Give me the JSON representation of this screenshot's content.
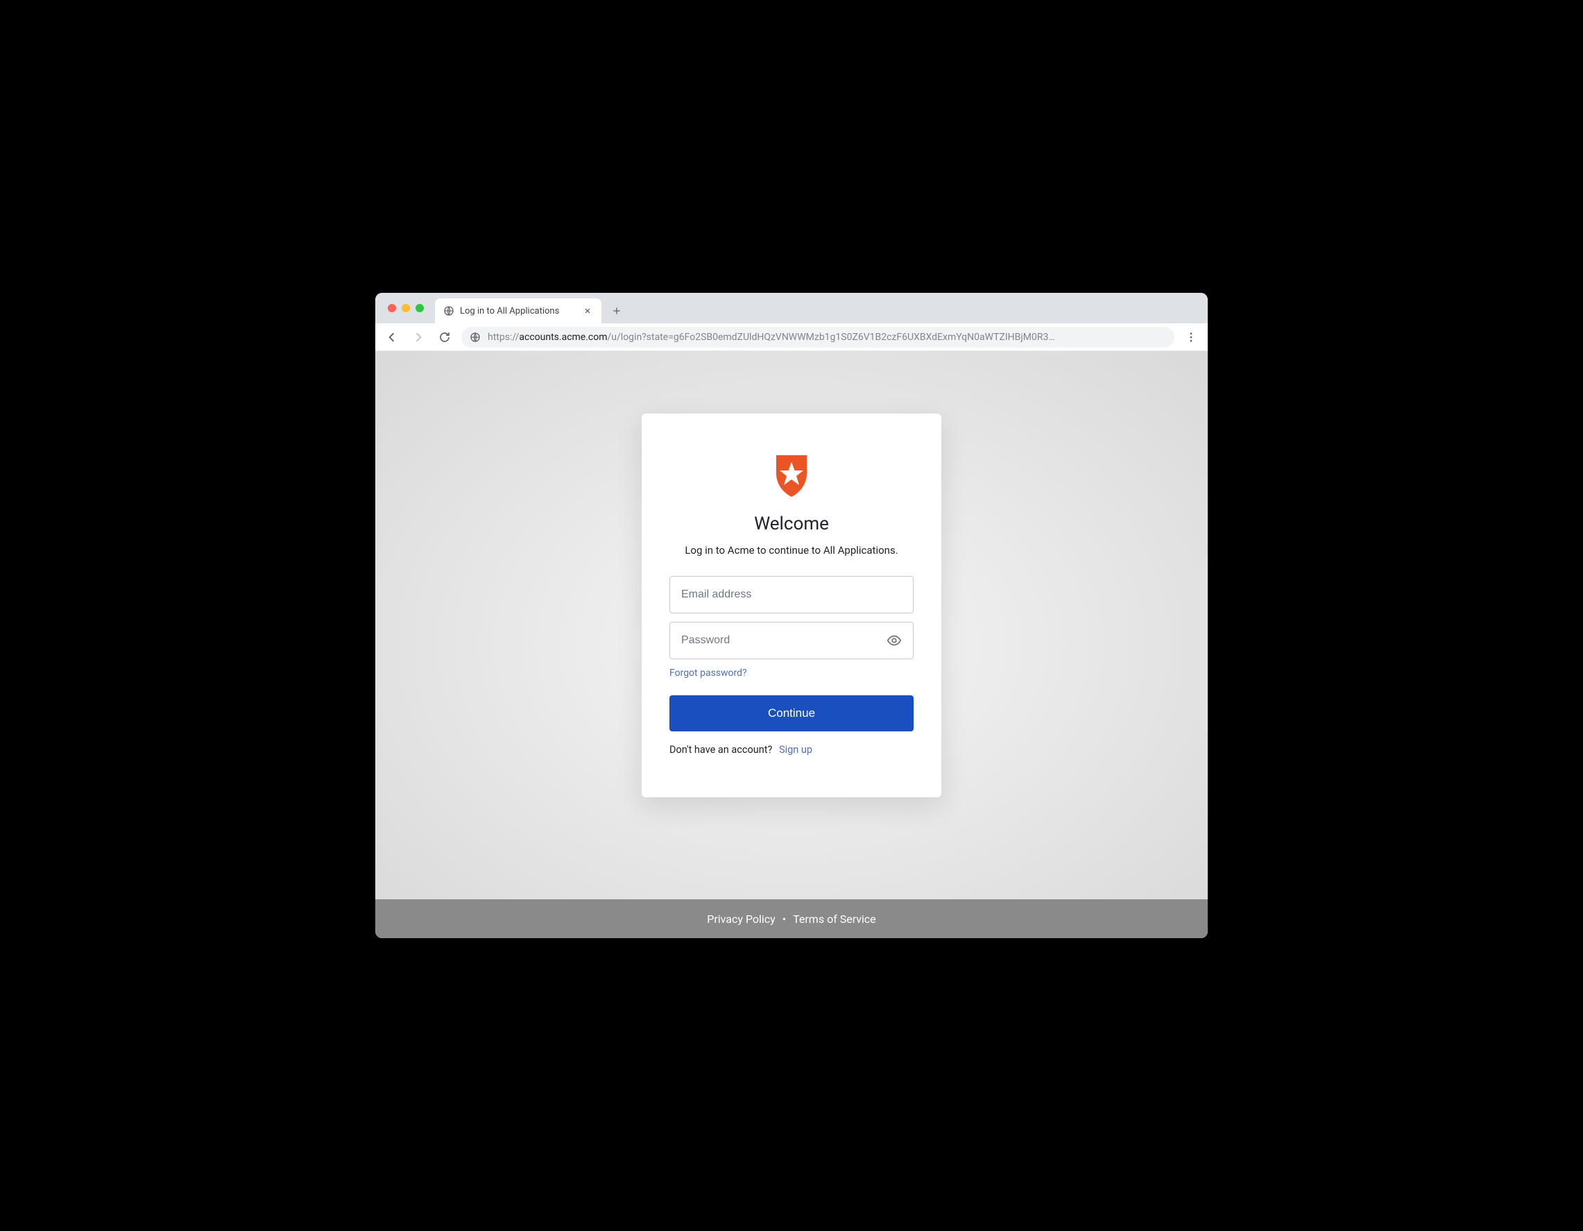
{
  "browser": {
    "tab": {
      "title": "Log in to All Applications"
    },
    "url": {
      "prefix": "https://",
      "host": "accounts.acme.com",
      "path": "/u/login?state=g6Fo2SB0emdZUldHQzVNWWMzb1g1S0Z6V1B2czF6UXBXdExmYqN0aWTZIHBjM0R3…"
    }
  },
  "login": {
    "title": "Welcome",
    "subtitle": "Log in to Acme to continue to All Applications.",
    "email_placeholder": "Email address",
    "password_placeholder": "Password",
    "forgot_label": "Forgot password?",
    "continue_label": "Continue",
    "signup_prompt": "Don't have an account?",
    "signup_link": "Sign up"
  },
  "footer": {
    "privacy": "Privacy Policy",
    "terms": "Terms of Service"
  },
  "colors": {
    "brand_orange": "#eb5424",
    "primary_blue": "#1a4fbf",
    "link_blue": "#4f6fb3"
  }
}
